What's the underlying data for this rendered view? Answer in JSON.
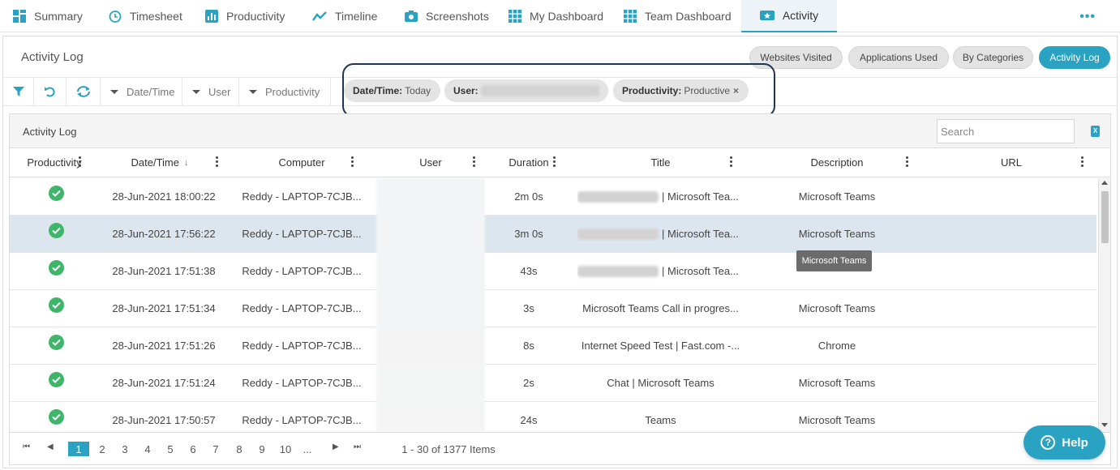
{
  "nav": {
    "tabs": [
      {
        "label": "Summary",
        "icon": "grid-icon"
      },
      {
        "label": "Timesheet",
        "icon": "clock-icon"
      },
      {
        "label": "Productivity",
        "icon": "bar-chart-icon"
      },
      {
        "label": "Timeline",
        "icon": "line-chart-icon"
      },
      {
        "label": "Screenshots",
        "icon": "camera-icon"
      },
      {
        "label": "My Dashboard",
        "icon": "dashboard-icon"
      },
      {
        "label": "Team Dashboard",
        "icon": "dashboard-icon"
      },
      {
        "label": "Activity",
        "icon": "star-badge-icon"
      }
    ],
    "active_tab": "Activity",
    "more": "•••"
  },
  "panel": {
    "title": "Activity Log",
    "views": [
      "Websites Visited",
      "Applications Used",
      "By Categories",
      "Activity Log"
    ],
    "active_view": "Activity Log"
  },
  "filters": {
    "dropdowns": [
      "Date/Time",
      "User",
      "Productivity"
    ],
    "chips": [
      {
        "label": "Date/Time:",
        "value": "Today"
      },
      {
        "label": "User:",
        "value": ""
      },
      {
        "label": "Productivity:",
        "value": "Productive",
        "close": "×"
      }
    ]
  },
  "grid": {
    "title": "Activity Log",
    "search_placeholder": "Search",
    "export_label": "X",
    "columns": [
      "Productivity",
      "Date/Time",
      "Computer",
      "User",
      "Duration",
      "Title",
      "Description",
      "URL"
    ],
    "sort_indicator": "↓",
    "rows": [
      {
        "datetime": "28-Jun-2021 18:00:22",
        "computer": "Reddy - LAPTOP-7CJB...",
        "duration": "2m 0s",
        "title": "| Microsoft Tea...",
        "description": "Microsoft Teams",
        "url": ""
      },
      {
        "datetime": "28-Jun-2021 17:56:22",
        "computer": "Reddy - LAPTOP-7CJB...",
        "duration": "3m 0s",
        "title": "| Microsoft Tea...",
        "description": "Microsoft Teams",
        "url": ""
      },
      {
        "datetime": "28-Jun-2021 17:51:38",
        "computer": "Reddy - LAPTOP-7CJB...",
        "duration": "43s",
        "title": "| Microsoft Tea...",
        "description": "",
        "url": ""
      },
      {
        "datetime": "28-Jun-2021 17:51:34",
        "computer": "Reddy - LAPTOP-7CJB...",
        "duration": "3s",
        "title": "Microsoft Teams Call in progres...",
        "description": "Microsoft Teams",
        "url": ""
      },
      {
        "datetime": "28-Jun-2021 17:51:26",
        "computer": "Reddy - LAPTOP-7CJB...",
        "duration": "8s",
        "title": "Internet Speed Test | Fast.com -...",
        "description": "Chrome",
        "url": ""
      },
      {
        "datetime": "28-Jun-2021 17:51:24",
        "computer": "Reddy - LAPTOP-7CJB...",
        "duration": "2s",
        "title": "Chat | Microsoft Teams",
        "description": "Microsoft Teams",
        "url": ""
      },
      {
        "datetime": "28-Jun-2021 17:50:57",
        "computer": "Reddy - LAPTOP-7CJB...",
        "duration": "24s",
        "title": "Teams",
        "description": "Microsoft Teams",
        "url": ""
      }
    ],
    "selected_row": 2,
    "tooltip": "Microsoft Teams"
  },
  "pager": {
    "pages": [
      "1",
      "2",
      "3",
      "4",
      "5",
      "6",
      "7",
      "8",
      "9",
      "10",
      "..."
    ],
    "current": "1",
    "summary": "1 - 30 of 1377 Items"
  },
  "help": {
    "label": "Help"
  },
  "colors": {
    "accent": "#2aa3c2",
    "productive": "#3fb56a",
    "highlight_border": "#1e3556",
    "selected_row": "#dde6ef"
  }
}
